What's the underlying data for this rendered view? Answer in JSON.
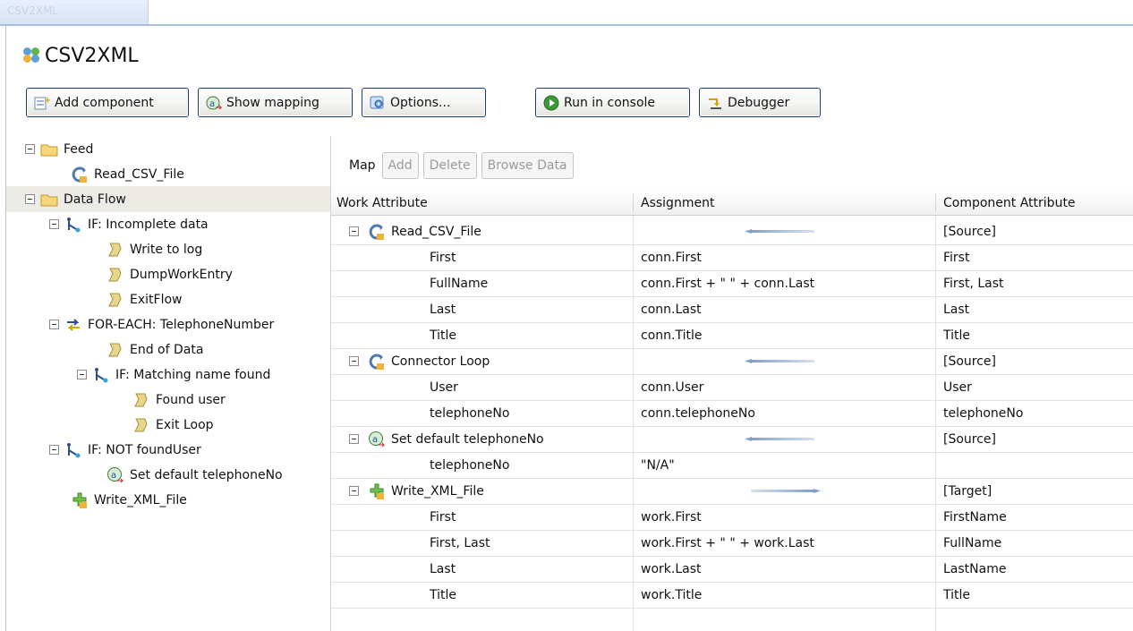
{
  "window": {
    "tab_title": "CSV2XML"
  },
  "app": {
    "title": "CSV2XML"
  },
  "toolbar": {
    "add_component": "Add component",
    "show_mapping": "Show mapping",
    "options": "Options...",
    "run_in_console": "Run in console",
    "debugger": "Debugger"
  },
  "tree": {
    "feed": "Feed",
    "read_csv": "Read_CSV_File",
    "data_flow": "Data Flow",
    "if_incomplete": "IF: Incomplete data",
    "write_to_log": "Write to log",
    "dump_work_entry": "DumpWorkEntry",
    "exit_flow": "ExitFlow",
    "for_each": "FOR-EACH: TelephoneNumber",
    "end_of_data": "End of Data",
    "if_matching": "IF: Matching name found",
    "found_user": "Found user",
    "exit_loop": "Exit Loop",
    "if_not_found": "IF: NOT foundUser",
    "set_default": "Set default telephoneNo",
    "write_xml": "Write_XML_File"
  },
  "map_bar": {
    "label": "Map",
    "add": "Add",
    "delete": "Delete",
    "browse": "Browse Data"
  },
  "grid": {
    "headers": [
      "Work Attribute",
      "Assignment",
      "Component Attribute"
    ],
    "rows": [
      {
        "a": "Read_CSV_File",
        "b": "",
        "c": "[Source]"
      },
      {
        "a": "First",
        "b": "conn.First",
        "c": "First"
      },
      {
        "a": "FullName",
        "b": "conn.First + \" \" + conn.Last",
        "c": "First, Last"
      },
      {
        "a": "Last",
        "b": "conn.Last",
        "c": "Last"
      },
      {
        "a": "Title",
        "b": "conn.Title",
        "c": "Title"
      },
      {
        "a": "Connector Loop",
        "b": "",
        "c": "[Source]"
      },
      {
        "a": "User",
        "b": "conn.User",
        "c": "User"
      },
      {
        "a": "telephoneNo",
        "b": "conn.telephoneNo",
        "c": "telephoneNo"
      },
      {
        "a": "Set default telephoneNo",
        "b": "",
        "c": "[Source]"
      },
      {
        "a": "telephoneNo",
        "b": "\"N/A\"",
        "c": ""
      },
      {
        "a": "Write_XML_File",
        "b": "",
        "c": "[Target]"
      },
      {
        "a": "First",
        "b": "work.First",
        "c": "FirstName"
      },
      {
        "a": "First, Last",
        "b": "work.First + \" \" + work.Last",
        "c": "FullName"
      },
      {
        "a": "Last",
        "b": "work.Last",
        "c": "LastName"
      },
      {
        "a": "Title",
        "b": "work.Title",
        "c": "Title"
      }
    ]
  },
  "colors": {
    "accent_border": "#1d3f6e",
    "arrow": "#7f9fcc",
    "selection": "#ecebe6"
  }
}
